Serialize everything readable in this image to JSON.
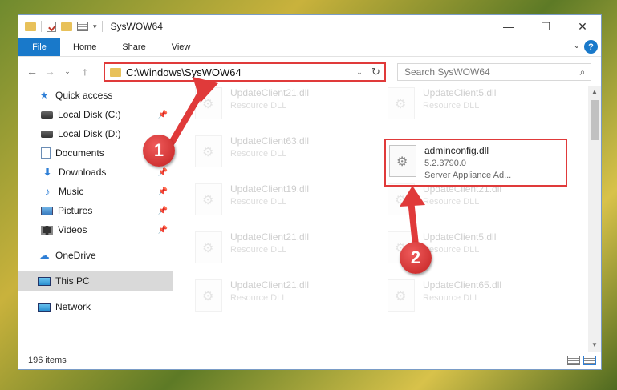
{
  "window": {
    "title": "SysWOW64",
    "controls": {
      "minimize": "—",
      "maximize": "☐",
      "close": "✕"
    }
  },
  "ribbon": {
    "tabs": [
      "File",
      "Home",
      "Share",
      "View"
    ],
    "help": "?",
    "chevron": "⌄"
  },
  "nav": {
    "back": "←",
    "forward": "→",
    "recent": "⌄",
    "up": "↑",
    "address": "C:\\Windows\\SysWOW64",
    "address_dropdown": "⌄",
    "refresh": "↻",
    "search_placeholder": "Search SysWOW64",
    "search_icon": "⌕"
  },
  "sidebar": {
    "quick_access": "Quick access",
    "items": [
      {
        "label": "Local Disk (C:)",
        "icon": "disk-icon",
        "pinned": true
      },
      {
        "label": "Local Disk (D:)",
        "icon": "disk-icon",
        "pinned": false
      },
      {
        "label": "Documents",
        "icon": "documents-icon",
        "pinned": true
      },
      {
        "label": "Downloads",
        "icon": "downloads-icon",
        "pinned": true
      },
      {
        "label": "Music",
        "icon": "music-icon",
        "pinned": true
      },
      {
        "label": "Pictures",
        "icon": "pictures-icon",
        "pinned": true
      },
      {
        "label": "Videos",
        "icon": "videos-icon",
        "pinned": true
      }
    ],
    "onedrive": "OneDrive",
    "this_pc": "This PC",
    "network": "Network",
    "pin_glyph": "📌"
  },
  "files": {
    "ghost": [
      {
        "name": "UpdateClient21.dll",
        "type": "Resource DLL"
      },
      {
        "name": "UpdateClient5.dll",
        "type": "Resource DLL"
      },
      {
        "name": "UpdateClient63.dll",
        "type": "Resource DLL"
      },
      {
        "name": "UpdateClient19.dll",
        "type": "Resource DLL"
      },
      {
        "name": "UpdateClient21.dll",
        "type": "Resource DLL"
      },
      {
        "name": "UpdateClient21.dll",
        "type": "Resource DLL"
      },
      {
        "name": "UpdateClient5.dll",
        "type": "Resource DLL"
      },
      {
        "name": "UpdateClient21.dll",
        "type": "Resource DLL"
      },
      {
        "name": "UpdateClient65.dll",
        "type": "Resource DLL"
      }
    ],
    "highlighted": {
      "name": "adminconfig.dll",
      "version": "5.2.3790.0",
      "description": "Server Appliance Ad..."
    }
  },
  "status": {
    "count": "196 items"
  },
  "annotations": {
    "step1": "1",
    "step2": "2",
    "color": "#e03a3a"
  }
}
